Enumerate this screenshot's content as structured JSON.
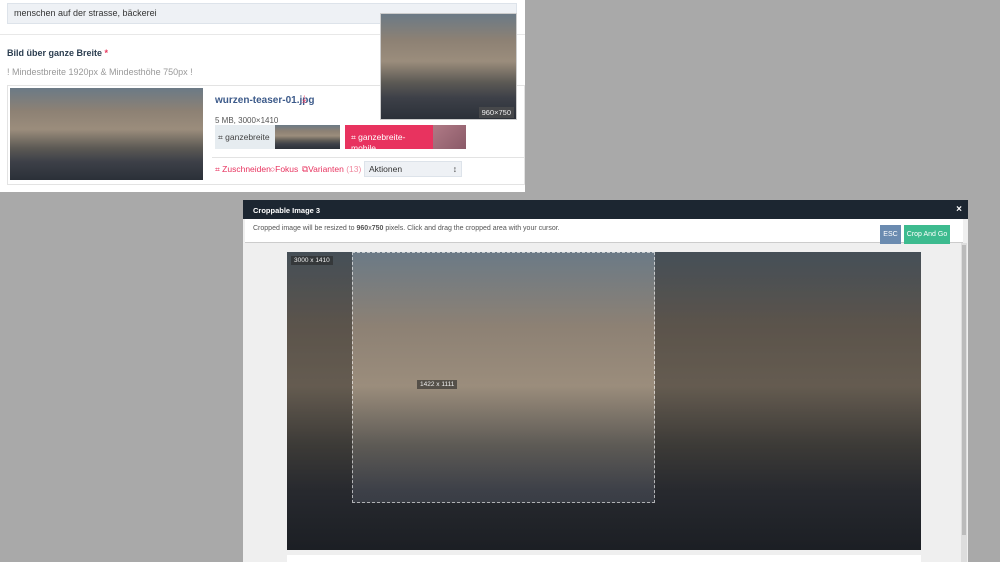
{
  "form": {
    "tags_value": "menschen auf der strasse, bäckerei",
    "field_label": "Bild über ganze Breite",
    "required_mark": "*",
    "hint": "! Mindestbreite 1920px & Mindesthöhe 750px !",
    "file_name": "wurzen-teaser-01.jpg",
    "file_meta": "5 MB, 3000×1410",
    "variants": [
      {
        "label": "ganzebreite"
      },
      {
        "label": "ganzebreite-mobile"
      }
    ],
    "actions": {
      "crop": "Zuschneiden",
      "focus": "Fokus",
      "variants": "Varianten",
      "variants_count": "(13)"
    },
    "select_value": "Aktionen",
    "preview_size": "960×750"
  },
  "modal": {
    "title": "Croppable Image 3",
    "close": "×",
    "info_pre": "Cropped image will be resized to ",
    "info_bold": "960",
    "info_x": "x",
    "info_bold2": "750",
    "info_post": " pixels. Click and drag the cropped area with your cursor.",
    "esc_label": "ESC",
    "crop_go_label": "Crop And Go",
    "image_size": "3000 x 1410",
    "crop_size": "1422 x 1111"
  }
}
